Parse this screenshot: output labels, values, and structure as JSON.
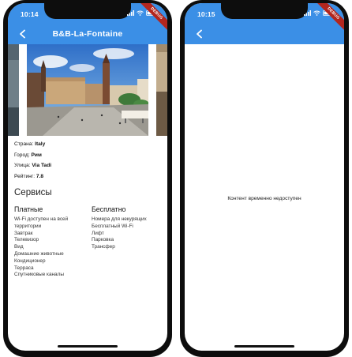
{
  "left_screen": {
    "status_time": "10:14",
    "debug_badge": "DEBUG",
    "title": "B&B-La-Fontaine",
    "info": [
      {
        "label": "Страна:",
        "value": "Italy"
      },
      {
        "label": "Город:",
        "value": "Рим"
      },
      {
        "label": "Улица:",
        "value": "Via Tadi"
      },
      {
        "label": "Рейтинг:",
        "value": "7.8"
      }
    ],
    "services_title": "Сервисы",
    "paid": {
      "title": "Платные",
      "items": [
        "Wi-Fi доступен на всей территории",
        "Завтрак",
        "Телевизор",
        "Вид",
        "Домашние животные",
        "Кондиционер",
        "Терраса",
        "Спутниковые каналы"
      ]
    },
    "free": {
      "title": "Бесплатно",
      "items": [
        "Номера для некурящих",
        "Бесплатный Wi-Fi",
        "Лифт",
        "Парковка",
        "Трансфер"
      ]
    }
  },
  "right_screen": {
    "status_time": "10:15",
    "debug_badge": "DEBUG",
    "empty_message": "Контент временно недоступен"
  },
  "colors": {
    "appbar": "#3b8fe6",
    "debug_ribbon": "#b3261e"
  },
  "icons": {
    "back": "arrow-back-icon",
    "wifi": "wifi-icon",
    "battery": "battery-icon"
  }
}
